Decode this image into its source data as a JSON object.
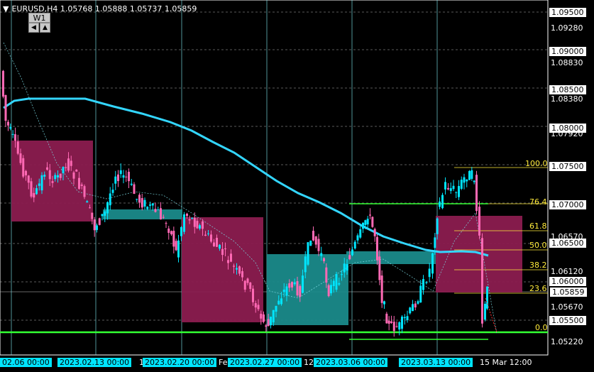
{
  "window": {
    "title": "EURUSD,H4  1.05768 1.05888 1.05737 1.05859",
    "arrow": "▼",
    "timeframe_label": "W1",
    "left_arrow": "◀",
    "up_arrow": "▲"
  },
  "colors": {
    "background": "#000000",
    "bull_candle": "#00e5ff",
    "bear_candle": "#ff69b4",
    "ma_line": "#33d6ff",
    "support_line": "#33ff33",
    "fib": "#ffeb3b",
    "zone_magenta": "#8b1c4f",
    "zone_teal": "#1a8a8a",
    "grid": "#ffffff"
  },
  "price_labels": [
    {
      "value": "1.09500",
      "boxed": true
    },
    {
      "value": "1.09280",
      "boxed": false
    },
    {
      "value": "1.09000",
      "boxed": true
    },
    {
      "value": "1.08830",
      "boxed": false
    },
    {
      "value": "1.08500",
      "boxed": true
    },
    {
      "value": "1.08380",
      "boxed": false
    },
    {
      "value": "1.08000",
      "boxed": true
    },
    {
      "value": "1.07920",
      "boxed": false
    },
    {
      "value": "1.07500",
      "boxed": true
    },
    {
      "value": "1.07000",
      "boxed": true
    },
    {
      "value": "1.06570",
      "boxed": false
    },
    {
      "value": "1.06500",
      "boxed": true
    },
    {
      "value": "1.06120",
      "boxed": false
    },
    {
      "value": "1.06000",
      "boxed": true
    },
    {
      "value": "1.05859",
      "boxed": true,
      "current": true
    },
    {
      "value": "1.05670",
      "boxed": false
    },
    {
      "value": "1.05500",
      "boxed": true
    },
    {
      "value": "1.05220",
      "boxed": false
    }
  ],
  "time_labels": [
    {
      "text": "02.06 00:00",
      "boxed": true
    },
    {
      "text": "2023.02.13 00:00",
      "boxed": true
    },
    {
      "text": "1",
      "boxed": false
    },
    {
      "text": "2023.02.20 00:00",
      "boxed": true
    },
    {
      "text": "Fe",
      "boxed": false
    },
    {
      "text": "2023.02.27 00:00",
      "boxed": true
    },
    {
      "text": "12",
      "boxed": false
    },
    {
      "text": "2023.03.06 00:00",
      "boxed": true
    },
    {
      "text": "2023.03.13 00:00",
      "boxed": true
    },
    {
      "text": "15 Mar 12:00",
      "boxed": false
    }
  ],
  "fib_levels": [
    {
      "label": "100.0"
    },
    {
      "label": "76.4"
    },
    {
      "label": "61.8"
    },
    {
      "label": "50.0"
    },
    {
      "label": "38.2"
    },
    {
      "label": "23.6"
    },
    {
      "label": "0.0"
    }
  ]
}
